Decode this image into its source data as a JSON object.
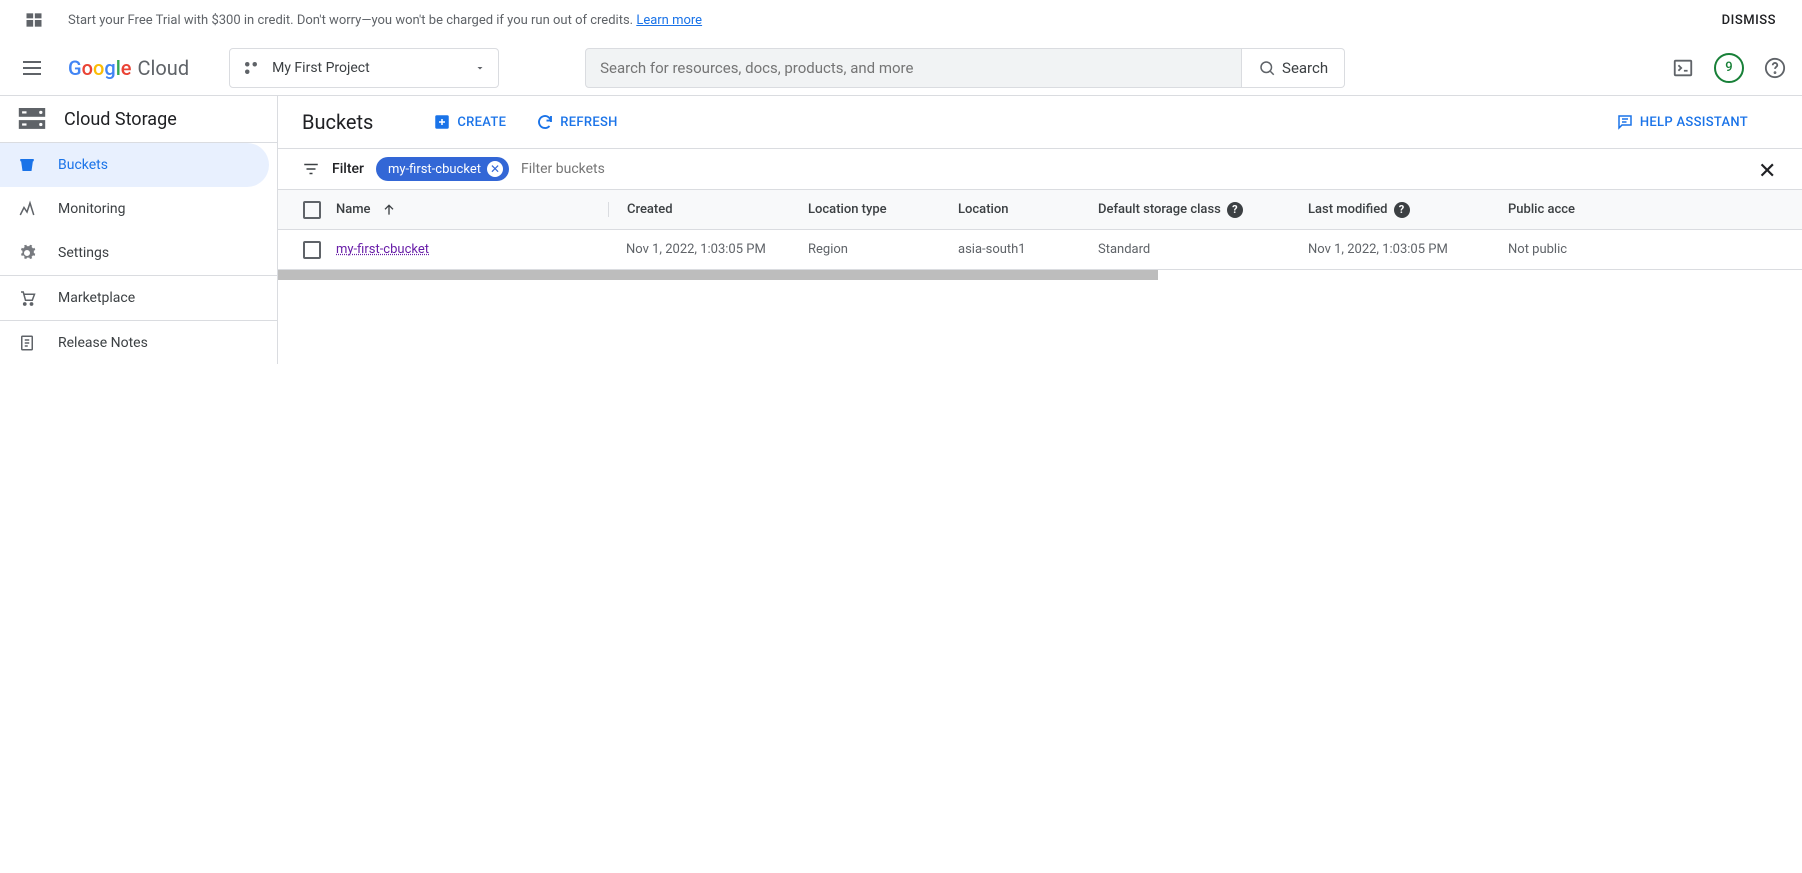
{
  "banner": {
    "text_part1": "Start your Free Trial with $300 in credit. Don't worry—you won't be charged if you run out of credits. ",
    "link": "Learn more",
    "dismiss": "DISMISS"
  },
  "header": {
    "logo_cloud": "Cloud",
    "project_name": "My First Project",
    "search_placeholder": "Search for resources, docs, products, and more",
    "search_btn": "Search",
    "notifications": "9"
  },
  "sidebar": {
    "title": "Cloud Storage",
    "items": [
      {
        "label": "Buckets"
      },
      {
        "label": "Monitoring"
      },
      {
        "label": "Settings"
      }
    ],
    "bottom": [
      {
        "label": "Marketplace"
      },
      {
        "label": "Release Notes"
      }
    ]
  },
  "main": {
    "title": "Buckets",
    "create": "CREATE",
    "refresh": "REFRESH",
    "help": "HELP ASSISTANT"
  },
  "filter": {
    "label": "Filter",
    "chip": "my-first-cbucket",
    "placeholder": "Filter buckets"
  },
  "table": {
    "headers": {
      "name": "Name",
      "created": "Created",
      "loctype": "Location type",
      "location": "Location",
      "class": "Default storage class",
      "modified": "Last modified",
      "public": "Public acce"
    },
    "rows": [
      {
        "name": "my-first-cbucket",
        "created": "Nov 1, 2022, 1:03:05 PM",
        "loctype": "Region",
        "location": "asia-south1",
        "class": "Standard",
        "modified": "Nov 1, 2022, 1:03:05 PM",
        "public": "Not public"
      }
    ]
  }
}
